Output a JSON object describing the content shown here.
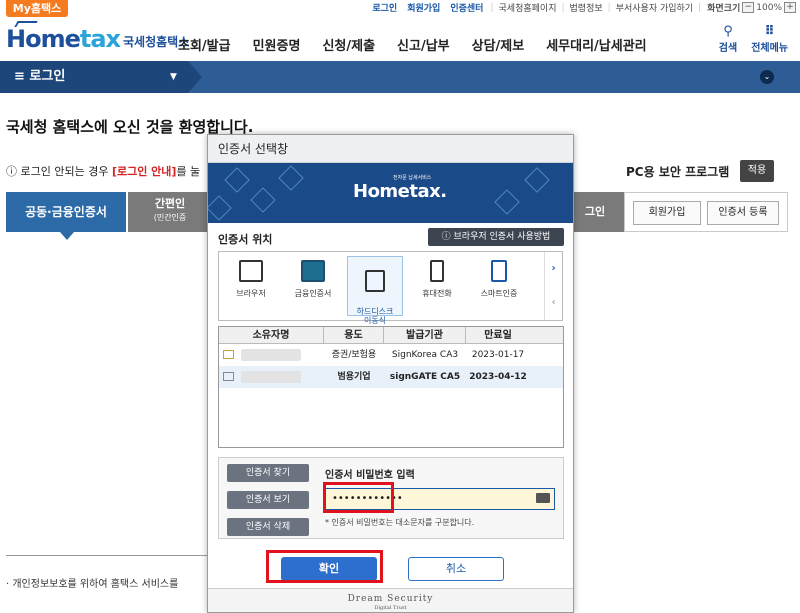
{
  "topbar": {
    "my_tab": "My홈택스",
    "links": [
      "로그인",
      "회원가입",
      "인증센터"
    ],
    "gray_links": [
      "국세청홈페이지",
      "법령정보",
      "부서사용자 가입하기"
    ],
    "zoom_label": "화면크기",
    "zoom_minus": "−",
    "zoom_value": "100%",
    "zoom_plus": "+"
  },
  "header": {
    "logo_text_a": "Home",
    "logo_text_b": "tax",
    "logo_kr": "국세청홈택스",
    "nav": [
      "조회/발급",
      "민원증명",
      "신청/제출",
      "신고/납부",
      "상담/제보",
      "세무대리/납세관리"
    ],
    "search_icon": "search-icon",
    "search_label": "검색",
    "menu_icon": "grid-icon",
    "menu_label": "전체메뉴"
  },
  "breadcrumb": {
    "label": "≡  로그인",
    "dropdown": "▼",
    "circle": "⌄"
  },
  "page": {
    "welcome": "국세청 홈택스에 오신 것을 환영합니다.",
    "notice_pre": "로그인 안되는 경우",
    "notice_red": "[로그인 안내]",
    "notice_post": "를 눌",
    "pc_security": "PC용 보안 프로그램",
    "apply": "적용",
    "tab1": "공동·금융인증서",
    "tab2": "간편인",
    "tab2_sub": "(민간인증",
    "tab3": "그인",
    "join_btn": "회원가입",
    "cert_reg_btn": "인증서 등록",
    "footnote": "· 개인정보보호를 위하여 홈택스 서비스를"
  },
  "modal": {
    "title": "인증서 선택창",
    "banner_logo": "Hometax.",
    "banner_sub": "전자문 납세서비스",
    "location_label": "인증서 위치",
    "guide_btn": "ⓘ 브라우저 인증서 사용방법",
    "locations": [
      {
        "label": "브라우저",
        "icon": "browser-icon"
      },
      {
        "label": "금융인증서",
        "icon": "financial-cert-icon"
      },
      {
        "label": "하드디스크\n이동식",
        "icon": "harddisk-icon"
      },
      {
        "label": "휴대전화",
        "icon": "phone-icon"
      },
      {
        "label": "스마트인증",
        "icon": "smart-cert-icon"
      }
    ],
    "arrow_right": "›",
    "arrow_left": "‹",
    "columns": [
      "소유자명",
      "용도",
      "발급기관",
      "만료일"
    ],
    "rows": [
      {
        "usage": "증권/보험용",
        "issuer": "SignKorea CA3",
        "expiry": "2023-01-17"
      },
      {
        "usage": "범용기업",
        "issuer": "signGATE CA5",
        "expiry": "2023-04-12"
      }
    ],
    "btn_find": "인증서 찾기",
    "btn_view": "인증서 보기",
    "btn_delete": "인증서 삭제",
    "pw_label": "인증서 비밀번호 입력",
    "pw_value": "••••••••••••",
    "pw_note": "* 인증서 비밀번호는 대소문자를 구분합니다.",
    "ok": "확인",
    "cancel": "취소",
    "footer_brand": "Dream Security",
    "footer_sub": "Digital Trust"
  },
  "colors": {
    "brand_blue": "#1c4f9c",
    "bar_blue": "#2e5d95",
    "accent_orange": "#f47b20",
    "highlight_red": "#e0121b"
  }
}
